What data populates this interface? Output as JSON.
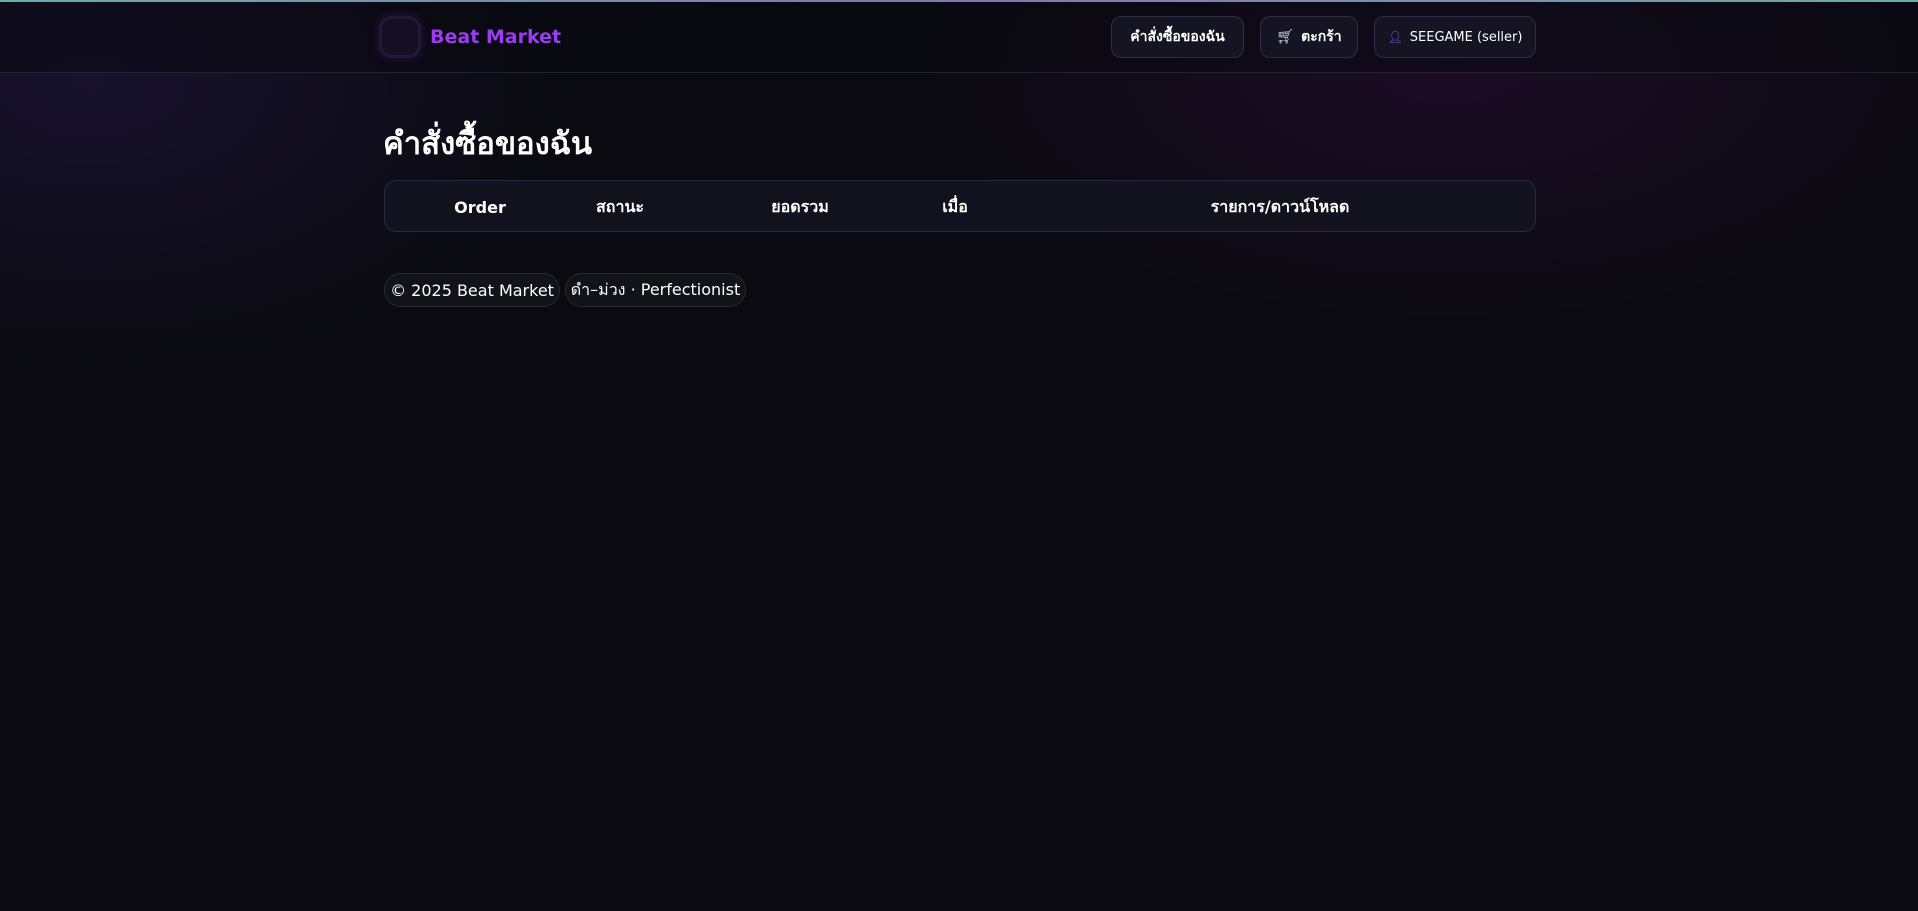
{
  "header": {
    "brand_name": "Beat Market",
    "nav": {
      "orders_label": "คำสั่งซื้อของฉัน",
      "cart_icon": "cart-icon",
      "cart_label": "ตะกร้า",
      "user_icon": "user-icon",
      "user_label": "SEEGAME (seller)"
    }
  },
  "main": {
    "title": "คำสั่งซื้อของฉัน",
    "table": {
      "columns": [
        "Order",
        "สถานะ",
        "ยอดรวม",
        "เมื่อ",
        "รายการ/ดาวน์โหลด"
      ],
      "rows": []
    }
  },
  "footer": {
    "copyright": "© 2025 Beat Market",
    "credit": "ดำ–ม่วง · Perfectionist"
  },
  "colors": {
    "background": "#0a0a10",
    "brand_accent": "#9b3cf2",
    "surface": "#141422",
    "border": "#2f2c46"
  }
}
